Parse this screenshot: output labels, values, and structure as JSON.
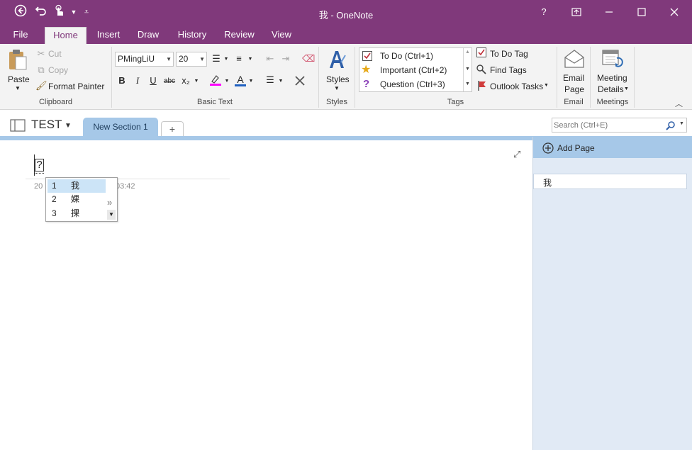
{
  "window": {
    "title": "我 - OneNote",
    "help_label": "?",
    "accent": "#80397b"
  },
  "quick_access": {
    "back_icon": "back-circle-icon",
    "undo_icon": "undo-icon",
    "touch_icon": "touch-mode-icon",
    "customize_icon": "customize-qat-icon"
  },
  "tabs": [
    {
      "label": "File"
    },
    {
      "label": "Home"
    },
    {
      "label": "Insert"
    },
    {
      "label": "Draw"
    },
    {
      "label": "History"
    },
    {
      "label": "Review"
    },
    {
      "label": "View"
    }
  ],
  "ribbon": {
    "clipboard": {
      "paste": "Paste",
      "cut": "Cut",
      "copy": "Copy",
      "format_painter": "Format Painter",
      "group": "Clipboard"
    },
    "basic_text": {
      "font": "PMingLiU",
      "size": "20",
      "bold": "B",
      "italic": "I",
      "underline": "U",
      "strike": "abc",
      "subscript": "x₂",
      "font_color": "A",
      "group": "Basic Text"
    },
    "styles": {
      "label": "Styles",
      "group": "Styles"
    },
    "tags": {
      "items": [
        {
          "label": "To Do (Ctrl+1)"
        },
        {
          "label": "Important (Ctrl+2)"
        },
        {
          "label": "Question (Ctrl+3)"
        }
      ],
      "todo_tag": "To Do Tag",
      "find_tags": "Find Tags",
      "outlook_tasks": "Outlook Tasks",
      "group": "Tags"
    },
    "email": {
      "line1": "Email",
      "line2": "Page",
      "group": "Email"
    },
    "meetings": {
      "line1": "Meeting",
      "line2": "Details",
      "group": "Meetings"
    }
  },
  "notebook": {
    "name": "TEST",
    "section": "New Section 1",
    "add_section": "+"
  },
  "search": {
    "placeholder": "Search (Ctrl+E)"
  },
  "page": {
    "title_char": "?",
    "date_start": "20",
    "time_end": "03:42"
  },
  "ime": {
    "candidates": [
      {
        "num": "1",
        "char": "我"
      },
      {
        "num": "2",
        "char": "婐"
      },
      {
        "num": "3",
        "char": "捰"
      }
    ],
    "more": "»"
  },
  "page_pane": {
    "add_page": "Add Page",
    "pages": [
      {
        "title": "我"
      }
    ]
  }
}
